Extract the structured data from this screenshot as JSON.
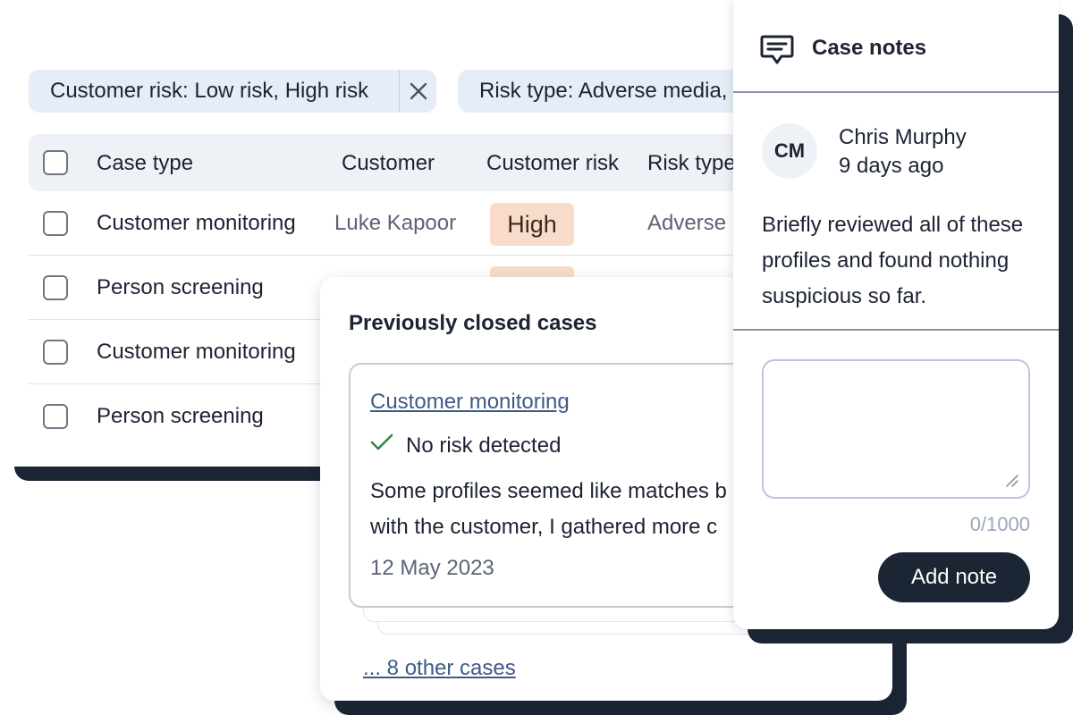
{
  "filters": {
    "chip1_label": "Customer risk: Low risk, High risk",
    "chip2_label": "Risk type: Adverse media,"
  },
  "table": {
    "headers": [
      "Case type",
      "Customer",
      "Customer risk",
      "Risk type"
    ],
    "rows": [
      {
        "case_type": "Customer monitoring",
        "customer": "Luke Kapoor",
        "risk": "High",
        "risk_type": "Adverse"
      },
      {
        "case_type": "Person screening",
        "customer": "",
        "risk": "",
        "risk_type": ""
      },
      {
        "case_type": "Customer monitoring",
        "customer": "",
        "risk": "",
        "risk_type": ""
      },
      {
        "case_type": "Person screening",
        "customer": "",
        "risk": "",
        "risk_type": ""
      }
    ]
  },
  "closed_cases": {
    "title": "Previously closed cases",
    "case_link": "Customer monitoring",
    "status": "No risk detected",
    "description_line1": "Some profiles seemed like matches b",
    "description_line2": "with the customer, I gathered more c",
    "date": "12 May 2023",
    "other_cases_link": "... 8 other cases"
  },
  "case_notes": {
    "title": "Case notes",
    "avatar_initials": "CM",
    "author": "Chris Murphy",
    "time": "9 days ago",
    "body_line1": "Briefly reviewed all of these",
    "body_line2": "profiles and found nothing",
    "body_line3": "suspicious so far.",
    "char_count": "0/1000",
    "add_button": "Add note"
  },
  "colors": {
    "navy": "#1b2534",
    "chip_bg": "#e7edf8",
    "high_risk_badge": "#f8dcc9",
    "link": "#3f5a86",
    "success_check": "#2e8b3e"
  },
  "icons": {
    "chip_close": "close-icon",
    "status": "check-icon",
    "notes": "chat-icon"
  }
}
